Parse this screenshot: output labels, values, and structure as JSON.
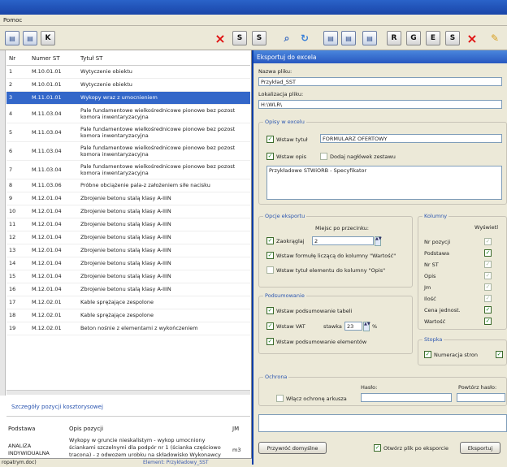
{
  "menu": {
    "label": "Pomoc"
  },
  "toolbar": {
    "buttons_left": [
      "doc-1",
      "doc-2",
      "k-button"
    ],
    "k_label": "K",
    "letters": [
      "S",
      "S",
      "R",
      "G",
      "E",
      "S"
    ],
    "delete_icon": "×",
    "search_icon": "⌕",
    "refresh_icon": "↻",
    "edit_icon": "✎"
  },
  "table": {
    "headers": [
      "Nr",
      "Numer ST",
      "Tytuł ST"
    ],
    "rows": [
      {
        "nr": "1",
        "numer": "M.10.01.01",
        "tytul": "Wytyczenie obiektu"
      },
      {
        "nr": "2",
        "numer": "M.10.01.01",
        "tytul": "Wytyczenie obiektu"
      },
      {
        "nr": "3",
        "numer": "M.11.01.01",
        "tytul": "Wykopy wraz z umocnieniem"
      },
      {
        "nr": "4",
        "numer": "M.11.03.04",
        "tytul": "Pale fundamentowe wielkośrednicowe pionowe bez pozost komora inwentaryzacyjna"
      },
      {
        "nr": "5",
        "numer": "M.11.03.04",
        "tytul": "Pale fundamentowe wielkośrednicowe pionowe bez pozost komora inwentaryzacyjna"
      },
      {
        "nr": "6",
        "numer": "M.11.03.04",
        "tytul": "Pale fundamentowe wielkośrednicowe pionowe bez pozost komora inwentaryzacyjna"
      },
      {
        "nr": "7",
        "numer": "M.11.03.04",
        "tytul": "Pale fundamentowe wielkośrednicowe pionowe bez pozost komora inwentaryzacyjna"
      },
      {
        "nr": "8",
        "numer": "M.11.03.06",
        "tytul": "Próbne obciążenie pala-z założeniem siłe nacisku"
      },
      {
        "nr": "9",
        "numer": "M.12.01.04",
        "tytul": "Zbrojenie betonu stalą klasy A-IIIN"
      },
      {
        "nr": "10",
        "numer": "M.12.01.04",
        "tytul": "Zbrojenie betonu stalą klasy A-IIIN"
      },
      {
        "nr": "11",
        "numer": "M.12.01.04",
        "tytul": "Zbrojenie betonu stalą klasy A-IIIN"
      },
      {
        "nr": "12",
        "numer": "M.12.01.04",
        "tytul": "Zbrojenie betonu stalą klasy A-IIIN"
      },
      {
        "nr": "13",
        "numer": "M.12.01.04",
        "tytul": "Zbrojenie betonu stalą klasy A-IIIN"
      },
      {
        "nr": "14",
        "numer": "M.12.01.04",
        "tytul": "Zbrojenie betonu stalą klasy A-IIIN"
      },
      {
        "nr": "15",
        "numer": "M.12.01.04",
        "tytul": "Zbrojenie betonu stalą klasy A-IIIN"
      },
      {
        "nr": "16",
        "numer": "M.12.01.04",
        "tytul": "Zbrojenie betonu stalą klasy A-IIIN"
      },
      {
        "nr": "17",
        "numer": "M.12.02.01",
        "tytul": "Kable sprężające zespolone"
      },
      {
        "nr": "18",
        "numer": "M.12.02.01",
        "tytul": "Kable sprężające zespolone"
      },
      {
        "nr": "19",
        "numer": "M.12.02.01",
        "tytul": "Beton nośnie z elementami z wykończeniem"
      }
    ]
  },
  "details": {
    "title": "Szczegóły pozycji kosztorysowej",
    "headers": [
      "Podstawa",
      "Opis pozycji",
      "JM"
    ],
    "podstawa": "ANALIZA INDYWIDUALNA",
    "opis": "Wykopy w gruncie nieskalistym - wykop umocniony ściankami szczelnymi dla podpór nr 1 (ścianka częściowo tracona) - z odwozem urobku na składowisko Wykonawcy",
    "jm": "m3"
  },
  "status": {
    "left": "ropatrym.doc)",
    "element": "Element: Przykładowy_SST"
  },
  "dialog": {
    "title": "Eksportuj do excela",
    "file_name_label": "Nazwa pliku:",
    "file_name": "Przykład_SST",
    "file_location_label": "Lokalizacja pliku:",
    "file_location": "H:\\WLR\\",
    "opisy_title": "Opisy w excelu",
    "wstaw_tytul_label": "Wstaw tytuł",
    "wstaw_tytul_value": "FORMULARZ OFERTOWY",
    "wstaw_opis_label": "Wstaw opis",
    "dodaj_naglowek_label": "Dodaj nagłówek zestawu",
    "opis_text": "Przykładowe STWiORB - Specyfikator",
    "opcje_title": "Opcje eksportu",
    "miejsc_label": "Miejsc po przecinku:",
    "zaokraglaj_label": "Zaokrąglaj",
    "zaokraglaj_value": "2",
    "formula_label": "Wstaw formułę liczącą do kolumny \"Wartość\"",
    "tytul_elementu_label": "Wstaw tytuł elementu do kolumny \"Opis\"",
    "podsumowanie_title": "Podsumowanie",
    "tabel_label": "Wstaw podsumowanie tabeli",
    "vat_label": "Wstaw VAT",
    "stawka_label": "stawka",
    "stawka_value": "23",
    "percent": "%",
    "elementow_label": "Wstaw podsumowanie elementów",
    "kolumny_title": "Kolumny",
    "wyswietl_label": "Wyświetl",
    "kolumny": [
      "Nr pozycji",
      "Podstawa",
      "Nr ST",
      "Opis",
      "Jm",
      "Ilość",
      "Cena jednost.",
      "Wartość"
    ],
    "stopka_title": "Stopka",
    "numeracja_label": "Numeracja stron",
    "ochrona_title": "Ochrona",
    "haslo_label": "Hasło:",
    "powtorz_label": "Powtórz hasło:",
    "wlacz_ochrone_label": "Włącz ochronę arkusza",
    "przywroc_button": "Przywróć domyślne",
    "otworz_label": "Otwórz plik po eksporcie",
    "eksportuj_button": "Eksportuj"
  }
}
